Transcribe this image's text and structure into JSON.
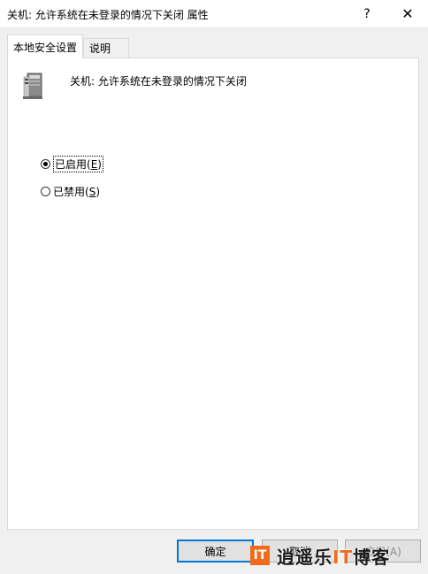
{
  "window": {
    "title": "关机: 允许系统在未登录的情况下关闭 属性",
    "help_label": "?",
    "close_label": "✕"
  },
  "tabs": [
    {
      "label": "本地安全设置",
      "active": true
    },
    {
      "label": "说明",
      "active": false
    }
  ],
  "policy": {
    "icon": "computer-tower-icon",
    "name": "关机: 允许系统在未登录的情况下关闭"
  },
  "options": [
    {
      "label": "已启用(",
      "mnemonic": "E",
      "suffix": ")",
      "checked": true
    },
    {
      "label": "已禁用(",
      "mnemonic": "S",
      "suffix": ")",
      "checked": false
    }
  ],
  "buttons": {
    "ok": "确定",
    "cancel": "取消",
    "apply": "应用(A)"
  },
  "watermark": {
    "logo_text": "IT",
    "text_part1": "逍遥乐",
    "text_accent": "IT",
    "text_part2": "博客"
  },
  "colors": {
    "accent": "#0078d7",
    "watermark_orange": "#f26b1d"
  }
}
